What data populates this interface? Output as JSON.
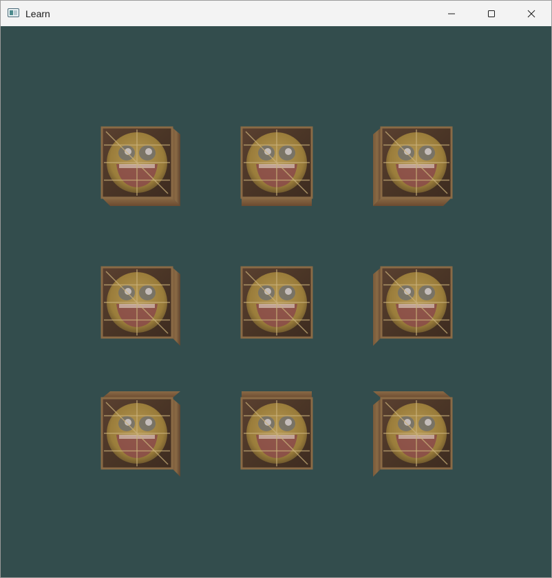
{
  "window": {
    "title": "Learn",
    "icon": "app-window-icon",
    "controls": [
      "minimize-icon",
      "maximize-icon",
      "close-icon"
    ],
    "background_color": "#334d4d"
  },
  "scene": {
    "object": "textured-crate-with-smiley-face",
    "grid_rows": 3,
    "grid_cols": 3,
    "cube_count": 9,
    "colors": {
      "wood_dark": "#4a3526",
      "wood_mid": "#6b4a30",
      "wood_light": "#8a6a45",
      "face_yellow": "#b89a4a",
      "mouth_red": "#8a4a4a"
    }
  }
}
